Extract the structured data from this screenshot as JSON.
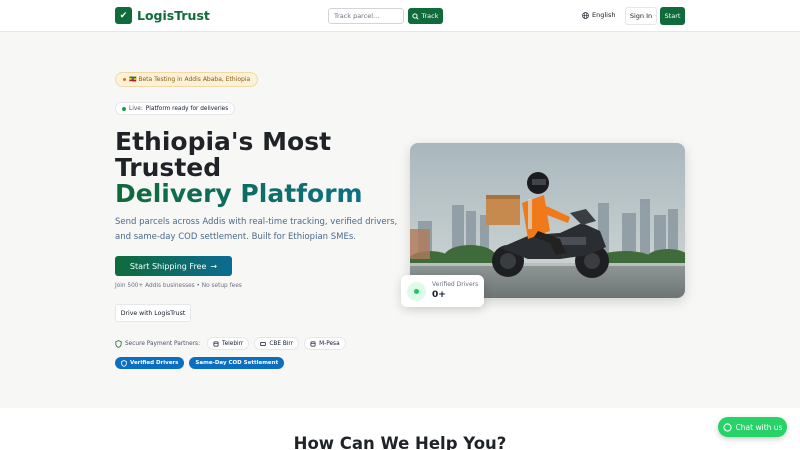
{
  "header": {
    "brand": "LogisTrust",
    "search_placeholder": "Track parcel...",
    "track_label": "Track",
    "language": "English",
    "signin_label": "Sign In",
    "start_label": "Start"
  },
  "hero": {
    "beta_badge": "🇪🇹 Beta Testing in Addis Ababa, Ethiopia",
    "live_label": "Live:",
    "live_text": "Platform ready for deliveries",
    "title_line1": "Ethiopia's Most",
    "title_line2": "Trusted",
    "title_accent": "Delivery Platform",
    "subtitle": "Send parcels across Addis with real-time tracking, verified drivers, and same-day COD settlement. Built for Ethiopian SMEs.",
    "cta_label": "Start Shipping Free",
    "join_text": "Join 500+ Addis businesses • No setup fees",
    "drive_label": "Drive with LogisTrust",
    "partners_label": "Secure Payment Partners:",
    "partners": [
      "Telebirr",
      "CBE Birr",
      "M-Pesa"
    ],
    "tags": [
      "Verified Drivers",
      "Same-Day COD Settlement"
    ]
  },
  "verified_card": {
    "label": "Verified Drivers",
    "value": "0+"
  },
  "section": {
    "title": "How Can We Help You?"
  },
  "chat": {
    "label": "Chat with us"
  },
  "colors": {
    "brand_green": "#0f6b3a",
    "accent_blue": "#0b6ec0",
    "whatsapp_green": "#25d366"
  }
}
